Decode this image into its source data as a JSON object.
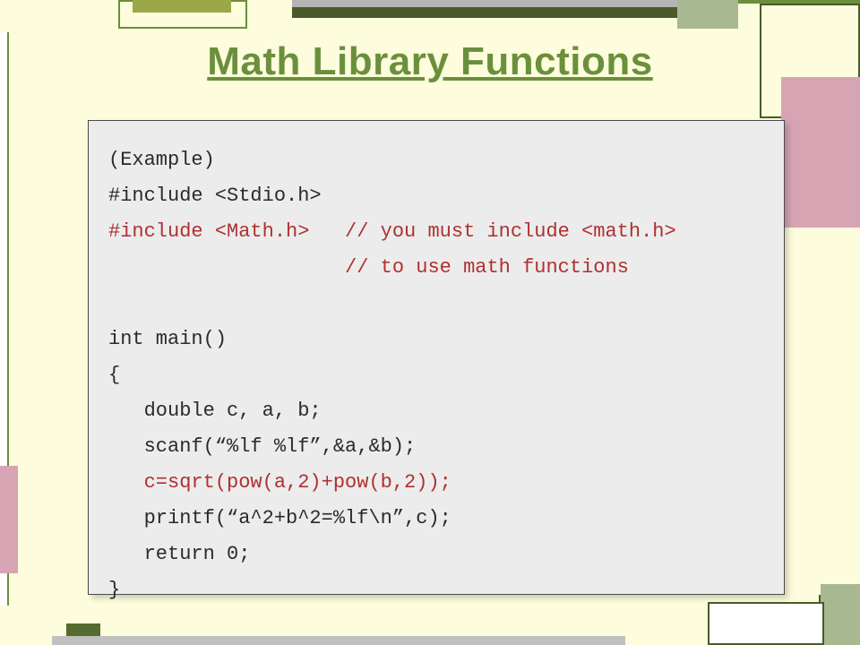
{
  "slide": {
    "title": "Math Library Functions",
    "code_lines": [
      {
        "color": "black",
        "text": "(Example)"
      },
      {
        "color": "black",
        "text": "#include <Stdio.h>"
      },
      {
        "segments": [
          {
            "color": "red",
            "text": "#include <Math.h>   "
          },
          {
            "color": "red",
            "text": "// you must include <math.h>"
          }
        ]
      },
      {
        "segments": [
          {
            "color": "red",
            "text": "                    // to use math functions"
          }
        ]
      },
      {
        "color": "black",
        "text": ""
      },
      {
        "color": "black",
        "text": "int main()"
      },
      {
        "color": "black",
        "text": "{"
      },
      {
        "color": "black",
        "text": "   double c, a, b;"
      },
      {
        "color": "black",
        "text": "   scanf(“%lf %lf”,&a,&b);"
      },
      {
        "color": "red",
        "text": "   c=sqrt(pow(a,2)+pow(b,2));"
      },
      {
        "color": "black",
        "text": "   printf(“a^2+b^2=%lf\\n”,c);"
      },
      {
        "color": "black",
        "text": "   return 0;"
      },
      {
        "color": "black",
        "text": "}"
      }
    ]
  }
}
